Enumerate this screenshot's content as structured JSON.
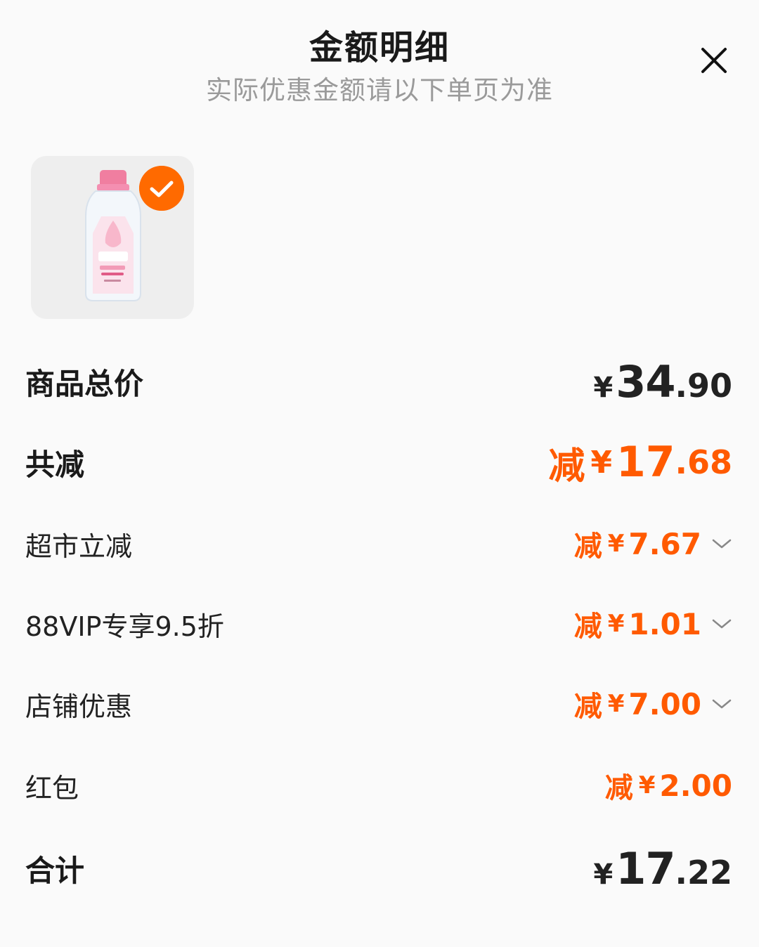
{
  "header": {
    "title": "金额明细",
    "subtitle": "实际优惠金额请以下单页为准"
  },
  "summary": {
    "total_label": "商品总价",
    "total_yen": "¥",
    "total_int": "34",
    "total_dec": ".90",
    "discount_label": "共减",
    "discount_prefix": "减",
    "discount_yen": "¥",
    "discount_int": "17",
    "discount_dec": ".68"
  },
  "discounts": [
    {
      "label": "超市立减",
      "prefix": "减",
      "yen": "¥",
      "value": "7.67"
    },
    {
      "label": "88VIP专享9.5折",
      "prefix": "减",
      "yen": "¥",
      "value": "1.01"
    },
    {
      "label": "店铺优惠",
      "prefix": "减",
      "yen": "¥",
      "value": "7.00"
    },
    {
      "label": "红包",
      "prefix": "减",
      "yen": "¥",
      "value": "2.00"
    }
  ],
  "final": {
    "label": "合计",
    "yen": "¥",
    "int": "17",
    "dec": ".22"
  },
  "colors": {
    "accent": "#ff5a00",
    "check_badge": "#ff6a00"
  },
  "icons": {
    "close": "close-icon",
    "check": "check-icon",
    "chevron": "chevron-down-icon"
  }
}
